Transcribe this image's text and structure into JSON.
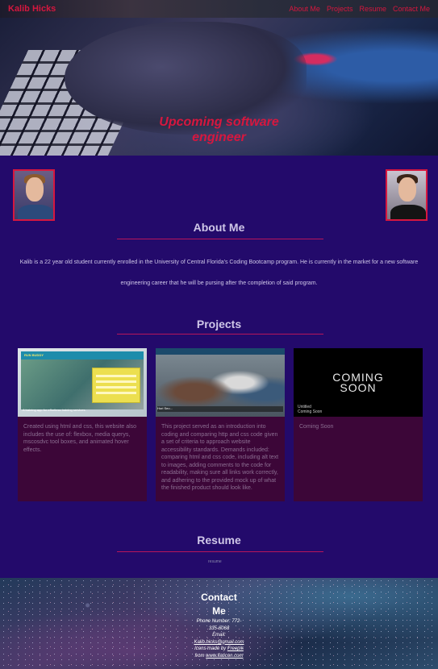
{
  "nav": {
    "brand": "Kalib Hicks",
    "links": [
      "About Me",
      "Projects",
      "Resume",
      "Contact Me"
    ]
  },
  "hero": {
    "title_line1": "Upcoming software",
    "title_line2": "engineer"
  },
  "about": {
    "heading": "About Me",
    "text_line1": "Kalib is a 22 year old student currently enrolled in the University of Central Florida's Coding Bootcamp program. He is currently in the market for a new software",
    "text_line2": "engineering career that he will be pursing after the completion of said program."
  },
  "projects": {
    "heading": "Projects",
    "cards": [
      {
        "description": "Created using html and css, this website also includes the use of: flexbox, media querys, mscosdvc tool boxes, and animated hover effects.",
        "image": {
          "logo": "RUN BUDDY",
          "caption": "A training app for effortless training services."
        }
      },
      {
        "description": "This project served as an introduction into coding and comparing http and css code given a set of criteria to approach website accessibility standards. Demands included: comparing html and css code, including alt text to images, adding comments to the code for readability, making sure all links work correctly, and adhering to the provided mock up of what the finished product should look like.",
        "image": {
          "caption": "Hori Seo..."
        }
      },
      {
        "description": "Coming Soon",
        "image": {
          "line1": "COMING",
          "line2": "SOON",
          "small1": "Untitled",
          "small2": "Coming Soon"
        }
      }
    ]
  },
  "resume": {
    "heading": "Resume",
    "image_alt": "resume"
  },
  "contact": {
    "title_line1": "Contact",
    "title_line2": "Me",
    "phone_line1": "Phone Number: 772-",
    "phone_line2": "335-6068",
    "email_label": "Email:",
    "email": "Kalib.hicks@gmail.com",
    "credit_prefix": "Icons made by ",
    "credit_author": "Freepik",
    "credit_from": "from ",
    "credit_site": "www.flaticon.com"
  },
  "colors": {
    "background": "#230a6b",
    "accent": "#d6173f",
    "card": "#3c0638",
    "rule": "#b8155a"
  }
}
